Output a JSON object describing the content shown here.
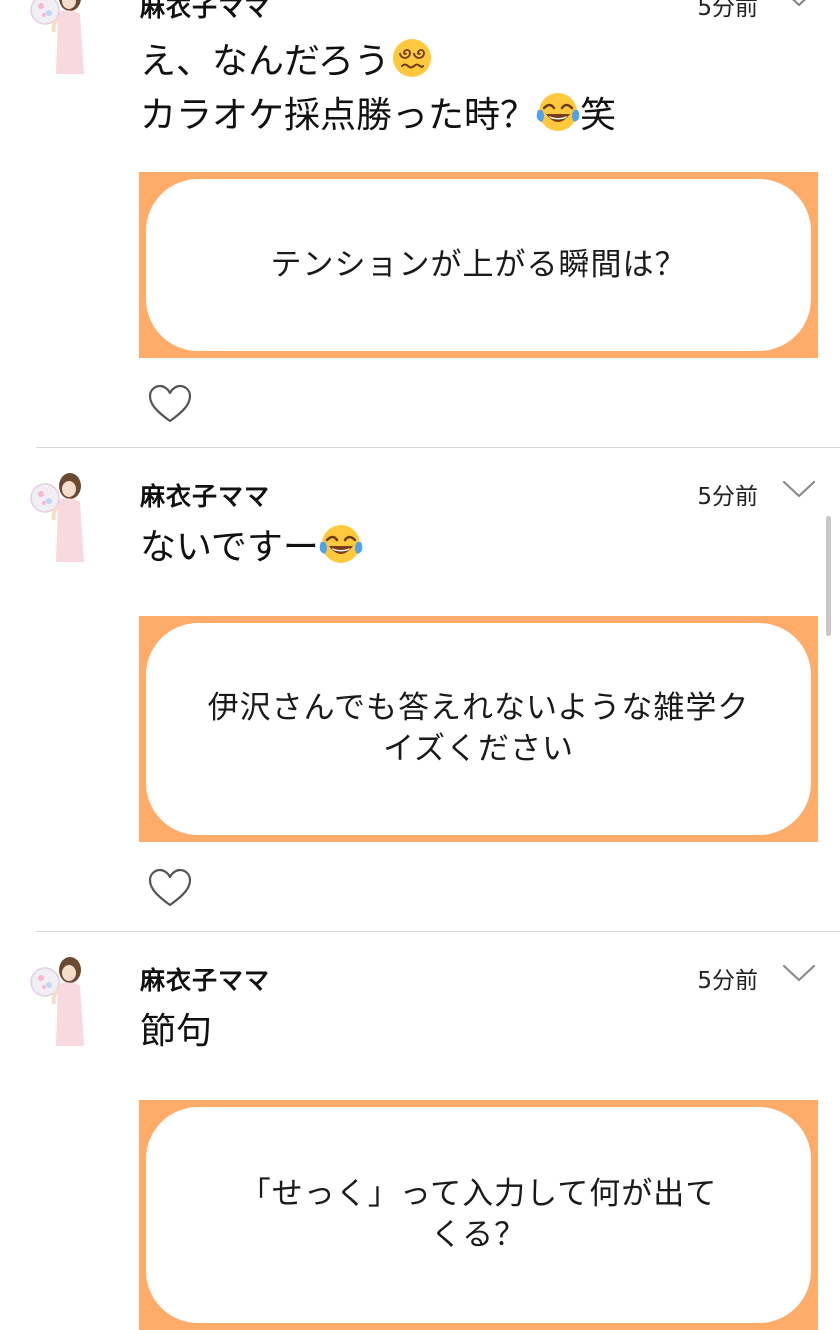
{
  "posts": [
    {
      "username": "麻衣子ママ",
      "timestamp": "5分前",
      "reply_lines": [
        {
          "text": "え、なんだろう",
          "emoji": "dizzy-face"
        },
        {
          "text": "カラオケ採点勝った時？",
          "emoji": "tears-of-joy",
          "suffix": "笑"
        }
      ],
      "question": "テンションが上がる瞬間は？",
      "like_icon": "heart-outline-icon"
    },
    {
      "username": "麻衣子ママ",
      "timestamp": "5分前",
      "reply_lines": [
        {
          "text": "ないですー",
          "emoji": "tears-of-joy"
        }
      ],
      "question_lines": [
        "伊沢さんでも答えれないような雑学ク",
        "イズください"
      ],
      "like_icon": "heart-outline-icon"
    },
    {
      "username": "麻衣子ママ",
      "timestamp": "5分前",
      "reply_lines": [
        {
          "text": "節句"
        }
      ],
      "question_lines": [
        "「せっく」って入力して何が出て",
        "くる？"
      ]
    }
  ],
  "colors": {
    "card_border": "#ffac6a",
    "divider": "#d6d6d6",
    "emoji_yellow": "#ffc83d"
  }
}
